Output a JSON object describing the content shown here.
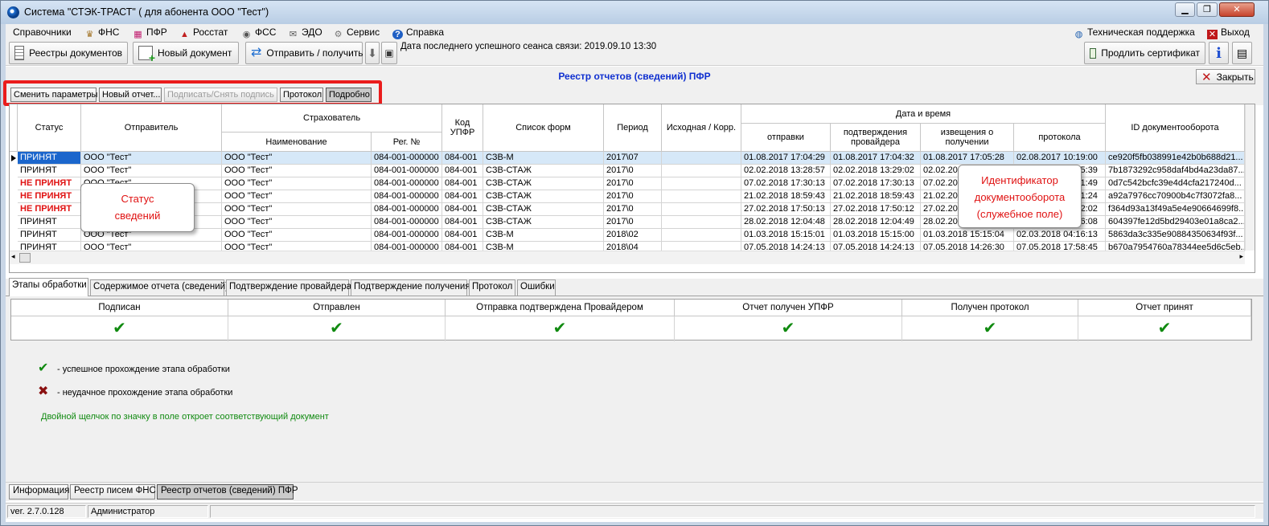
{
  "window": {
    "title": "Система \"СТЭК-ТРАСТ\" ( для абонента ООО \"Тест\")"
  },
  "menu": {
    "items": [
      {
        "label": "Справочники",
        "icon": "none"
      },
      {
        "label": "ФНС",
        "icon": "fns-eagle-icon"
      },
      {
        "label": "ПФР",
        "icon": "pfr-icon"
      },
      {
        "label": "Росстат",
        "icon": "rosstat-icon"
      },
      {
        "label": "ФСС",
        "icon": "fss-icon"
      },
      {
        "label": "ЭДО",
        "icon": "edo-icon"
      },
      {
        "label": "Сервис",
        "icon": "gear-icon"
      },
      {
        "label": "Справка",
        "icon": "help-icon"
      }
    ],
    "support": "Техническая поддержка",
    "exit": "Выход"
  },
  "toolbar": {
    "registers": "Реестры документов",
    "new_doc": "Новый документ",
    "send_receive": "Отправить / получить",
    "last_session": "Дата последнего успешного сеанса связи: 2019.09.10 13:30",
    "renew_cert": "Продлить сертификат"
  },
  "registry": {
    "title": "Реестр отчетов (сведений) ПФР",
    "close": "Закрыть"
  },
  "actions": {
    "change_params": "Сменить параметры",
    "new_report": "Новый отчет...",
    "sign": "Подписать/Снять подпись",
    "protocol": "Протокол",
    "details": "Подробно"
  },
  "grid": {
    "headers": {
      "status": "Статус",
      "sender": "Отправитель",
      "insurer": "Страхователь",
      "name": "Наименование",
      "reg": "Рег. №",
      "upfr": "Код УПФР",
      "forms": "Список форм",
      "period": "Период",
      "orig": "Исходная / Корр.",
      "datetime": "Дата и время",
      "sent": "отправки",
      "prov": "подтверждения провайдера",
      "notice": "извещения о получении",
      "proto": "протокола",
      "docflow": "ID документооборота"
    },
    "rows": [
      {
        "status": "ПРИНЯТ",
        "bad": false,
        "sender": "ООО \"Тест\"",
        "name": "ООО \"Тест\"",
        "reg": "084-001-000000",
        "upfr": "084-001",
        "forms": "СЗВ-М",
        "period": "2017\\07",
        "orig": "",
        "sent": "01.08.2017 17:04:29",
        "prov": "01.08.2017 17:04:32",
        "notice": "01.08.2017 17:05:28",
        "proto": "02.08.2017 10:19:00",
        "id": "ce920f5fb038991e42b0b688d21..."
      },
      {
        "status": "ПРИНЯТ",
        "bad": false,
        "sender": "ООО \"Тест\"",
        "name": "ООО \"Тест\"",
        "reg": "084-001-000000",
        "upfr": "084-001",
        "forms": "СЗВ-СТАЖ",
        "period": "2017\\0",
        "orig": "",
        "sent": "02.02.2018 13:28:57",
        "prov": "02.02.2018 13:29:02",
        "notice": "02.02.2018 13:29:14",
        "proto": "02.02.2018 15:15:39",
        "id": "7b1873292c958daf4bd4a23da87..."
      },
      {
        "status": "НЕ ПРИНЯТ",
        "bad": true,
        "sender": "ООО \"Тест\"",
        "name": "ООО \"Тест\"",
        "reg": "084-001-000000",
        "upfr": "084-001",
        "forms": "СЗВ-СТАЖ",
        "period": "2017\\0",
        "orig": "",
        "sent": "07.02.2018 17:30:13",
        "prov": "07.02.2018 17:30:13",
        "notice": "07.02.2018 17:30:49",
        "proto": "07.02.2018 17:31:49",
        "id": "0d7c542bcfc39e4d4cfa217240d..."
      },
      {
        "status": "НЕ ПРИНЯТ",
        "bad": true,
        "sender": "ООО \"Тест\"",
        "name": "ООО \"Тест\"",
        "reg": "084-001-000000",
        "upfr": "084-001",
        "forms": "СЗВ-СТАЖ",
        "period": "2017\\0",
        "orig": "",
        "sent": "21.02.2018 18:59:43",
        "prov": "21.02.2018 18:59:43",
        "notice": "21.02.2018 19:00:24",
        "proto": "21.02.2018 19:01:24",
        "id": "a92a7976cc70900b4c7f3072fa8..."
      },
      {
        "status": "НЕ ПРИНЯТ",
        "bad": true,
        "sender": "ООО \"Тест\"",
        "name": "ООО \"Тест\"",
        "reg": "084-001-000000",
        "upfr": "084-001",
        "forms": "СЗВ-СТАЖ",
        "period": "2017\\0",
        "orig": "",
        "sent": "27.02.2018 17:50:13",
        "prov": "27.02.2018 17:50:12",
        "notice": "27.02.2018 17:51:02",
        "proto": "27.02.2018 17:52:02",
        "id": "f364d93a13f49a5e4e90664699f8..."
      },
      {
        "status": "ПРИНЯТ",
        "bad": false,
        "sender": "ООО \"Тест\"",
        "name": "ООО \"Тест\"",
        "reg": "084-001-000000",
        "upfr": "084-001",
        "forms": "СЗВ-СТАЖ",
        "period": "2017\\0",
        "orig": "",
        "sent": "28.02.2018 12:04:48",
        "prov": "28.02.2018 12:04:49",
        "notice": "28.02.2018 12:05:08",
        "proto": "28.02.2018 12:06:08",
        "id": "604397fe12d5bd29403e01a8ca2..."
      },
      {
        "status": "ПРИНЯТ",
        "bad": false,
        "sender": "ООО \"Тест\"",
        "name": "ООО \"Тест\"",
        "reg": "084-001-000000",
        "upfr": "084-001",
        "forms": "СЗВ-М",
        "period": "2018\\02",
        "orig": "",
        "sent": "01.03.2018 15:15:01",
        "prov": "01.03.2018 15:15:00",
        "notice": "01.03.2018 15:15:04",
        "proto": "02.03.2018 04:16:13",
        "id": "5863da3c335e90884350634f93f..."
      },
      {
        "status": "ПРИНЯТ",
        "bad": false,
        "sender": "ООО \"Тест\"",
        "name": "ООО \"Тест\"",
        "reg": "084-001-000000",
        "upfr": "084-001",
        "forms": "СЗВ-М",
        "period": "2018\\04",
        "orig": "",
        "sent": "07.05.2018 14:24:13",
        "prov": "07.05.2018 14:24:13",
        "notice": "07.05.2018 14:26:30",
        "proto": "07.05.2018 17:58:45",
        "id": "b670a7954760a78344ee5d6c5eb..."
      }
    ]
  },
  "callouts": {
    "status": "Статус сведений",
    "docflow": "Идентификатор документооборота (служебное поле)"
  },
  "tabs": [
    "Этапы обработки",
    "Содержимое отчета (сведений)",
    "Подтверждение провайдера",
    "Подтверждение получения",
    "Протокол",
    "Ошибки"
  ],
  "stages": {
    "headers": [
      "Подписан",
      "Отправлен",
      "Отправка подтверждена Провайдером",
      "Отчет получен УПФР",
      "Получен протокол",
      "Отчет принят"
    ],
    "check_color": "#108a10"
  },
  "legend": {
    "ok": "- успешное прохождение этапа обработки",
    "fail": "- неудачное прохождение этапа обработки",
    "hint": "Двойной щелчок по значку в поле откроет соответствующий документ"
  },
  "bottom_tabs": [
    "Информация",
    "Реестр писем ФНС",
    "Реестр отчетов (сведений) ПФР"
  ],
  "status": {
    "version": "ver. 2.7.0.128",
    "user": "Администратор"
  }
}
